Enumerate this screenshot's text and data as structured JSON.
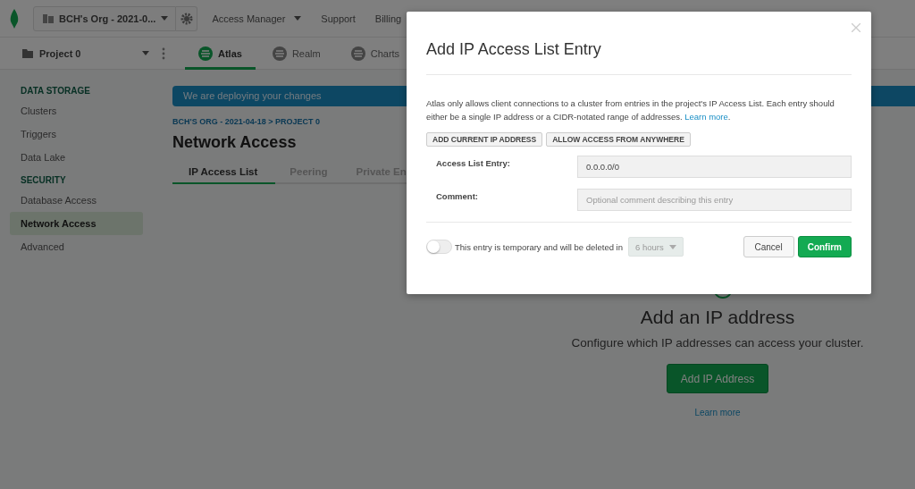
{
  "top_bar": {
    "org": "BCH's Org - 2021-0...",
    "links": [
      {
        "label": "Access Manager",
        "dropdown": true
      },
      {
        "label": "Support",
        "dropdown": false
      },
      {
        "label": "Billing",
        "dropdown": false
      }
    ]
  },
  "project_bar": {
    "project": "Project 0",
    "tabs": [
      {
        "label": "Atlas",
        "selected": true
      },
      {
        "label": "Realm",
        "selected": false
      },
      {
        "label": "Charts",
        "selected": false
      }
    ]
  },
  "sidebar": {
    "sections": [
      {
        "title": "DATA STORAGE",
        "items": [
          {
            "label": "Clusters",
            "selected": false
          },
          {
            "label": "Triggers",
            "selected": false
          },
          {
            "label": "Data Lake",
            "selected": false
          }
        ]
      },
      {
        "title": "SECURITY",
        "items": [
          {
            "label": "Database Access",
            "selected": false
          },
          {
            "label": "Network Access",
            "selected": true
          },
          {
            "label": "Advanced",
            "selected": false
          }
        ]
      }
    ]
  },
  "banner": "We are deploying your changes",
  "breadcrumb": "BCH'S ORG - 2021-04-18 > PROJECT 0",
  "page_title": "Network Access",
  "tabs": [
    {
      "label": "IP Access List",
      "selected": true
    },
    {
      "label": "Peering",
      "selected": false
    },
    {
      "label": "Private En",
      "selected": false
    }
  ],
  "empty_state": {
    "title": "Add an IP address",
    "subtitle": "Configure which IP addresses can access your cluster.",
    "button": "Add IP Address",
    "link": "Learn more"
  },
  "modal": {
    "title": "Add IP Access List Entry",
    "description": "Atlas only allows client connections to a cluster from entries in the project's IP Access List. Each entry should either be a single IP address or a CIDR-notated range of addresses.",
    "description_link": "Learn more",
    "description_end": ".",
    "quick_buttons": [
      "ADD CURRENT IP ADDRESS",
      "ALLOW ACCESS FROM ANYWHERE"
    ],
    "fields": [
      {
        "label": "Access List Entry:",
        "value": "0.0.0.0/0"
      },
      {
        "label": "Comment:",
        "placeholder": "Optional comment describing this entry"
      }
    ],
    "temporary": {
      "checked": false,
      "label": "This entry is temporary and will be deleted in",
      "duration": "6 hours",
      "disabled": true
    },
    "buttons": [
      {
        "label": "Cancel",
        "kind": "secondary"
      },
      {
        "label": "Confirm",
        "kind": "primary"
      }
    ]
  }
}
